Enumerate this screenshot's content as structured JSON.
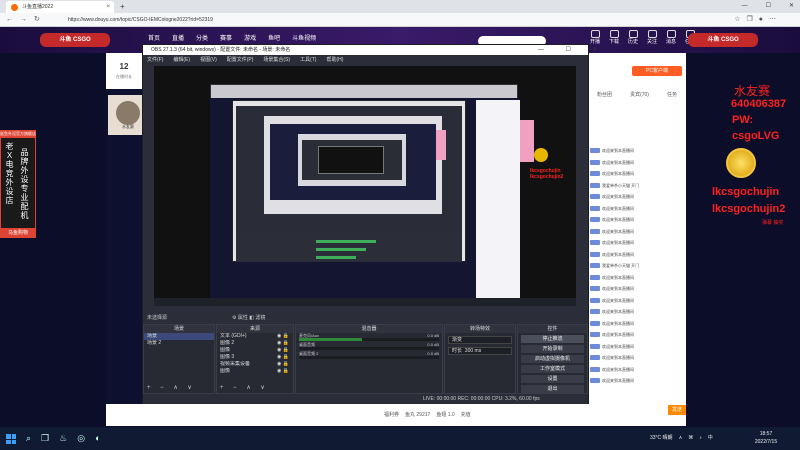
{
  "browser": {
    "tab_title": "斗鱼直播2022",
    "url": "https://www.douyu.com/topic/CSGO-IEMCologne2022?rid=52319",
    "close_glyph": "×",
    "new_tab_glyph": "+"
  },
  "douyu": {
    "logo_text": "斗鱼 CSGO",
    "nav": [
      "首页",
      "直播",
      "分类",
      "赛事",
      "游戏",
      "鱼吧",
      "斗鱼视频"
    ],
    "header_icons": [
      "开播",
      "下载",
      "历史",
      "关注",
      "消息",
      "任务"
    ],
    "viewer_count": "12",
    "viewer_label": "在播时长",
    "pc_button": "PC客户端",
    "streamer_label": "水友赛",
    "chat_tabs": [
      "粉丝团",
      "贵宾(70)",
      "任务"
    ],
    "chat_rows": [
      "欢迎来到本直播间",
      "欢迎来到本直播间",
      "欢迎来到本直播间",
      "我爱单杀小天猫 开门",
      "欢迎来到本直播间",
      "欢迎来到本直播间",
      "欢迎来到本直播间",
      "欢迎来到本直播间",
      "欢迎来到本直播间",
      "欢迎来到本直播间",
      "我爱单杀小天猫 开门",
      "欢迎来到本直播间",
      "欢迎来到本直播间",
      "欢迎来到本直播间",
      "欢迎来到本直播间",
      "欢迎来到本直播间",
      "欢迎来到本直播间",
      "欢迎来到本直播间",
      "欢迎来到本直播间",
      "欢迎来到本直播间",
      "欢迎来到本直播间"
    ],
    "send_label": "发送",
    "gift_labels": [
      "福利券",
      "鱼丸 29217",
      "鱼翅 1.0",
      "充值"
    ],
    "left_ad": {
      "title": "鲨鱼外设官方旗舰店",
      "col1": "老X电竞外设店",
      "col2": "品牌外设专业配机",
      "button": "马鱼购物"
    }
  },
  "overlay": {
    "line1": "水友赛",
    "line2": "640406387",
    "line3": "PW:",
    "line4": "csgoLVG",
    "line5": "lkcsgochujin",
    "line6": "lkcsgochujin2",
    "line7": "弹幕 抽奖"
  },
  "obs": {
    "title": "OBS 27.1.3 (64 bit, windows) - 配置文件: 未命名 - 场景: 未命名",
    "window_controls": "— ☐ ✕",
    "menu": [
      "文件(F)",
      "编辑(E)",
      "视图(V)",
      "配置文件(P)",
      "场景集合(S)",
      "工具(T)",
      "帮助(H)"
    ],
    "scene_info": "未选择源",
    "properties_label": "属性",
    "filters_label": "滤镜",
    "docks": {
      "scenes": "场景",
      "sources": "来源",
      "mixer": "混音器",
      "transitions": "转场特效",
      "controls": "控件"
    },
    "scenes": [
      "场景",
      "场景 2"
    ],
    "sources": [
      "文本 (GDI+)",
      "图像 2",
      "图像",
      "图像 3",
      "视频采集设备",
      "图像"
    ],
    "mixer_tracks": [
      {
        "label": "麦克风/Aux",
        "db": "0.0 dB",
        "level": 0.45
      },
      {
        "label": "桌面音频",
        "db": "0.0 dB",
        "level": 0.0
      },
      {
        "label": "桌面音频 2",
        "db": "0.0 dB",
        "level": 0.0
      }
    ],
    "transition": {
      "type": "渐变",
      "duration_label": "时长",
      "duration_value": "300 ms"
    },
    "controls": [
      "停止推流",
      "开始录制",
      "启动虚拟摄像机",
      "工作室模式",
      "设置",
      "退出"
    ],
    "status": "LIVE: 00:00:00   REC: 00:00:00   CPU: 3.2%, 60.00 fps",
    "foot_glyphs": "+ − ∧ ∨"
  },
  "taskbar": {
    "weather": "33°C 晴朗",
    "lang": "中",
    "time": "18:57",
    "date": "2022/7/15"
  },
  "colors": {
    "accent_orange": "#ff5d23",
    "overlay_red": "#ff2020",
    "obs_bg": "#2b2e38",
    "douyu_header": "#3a1a6a"
  }
}
